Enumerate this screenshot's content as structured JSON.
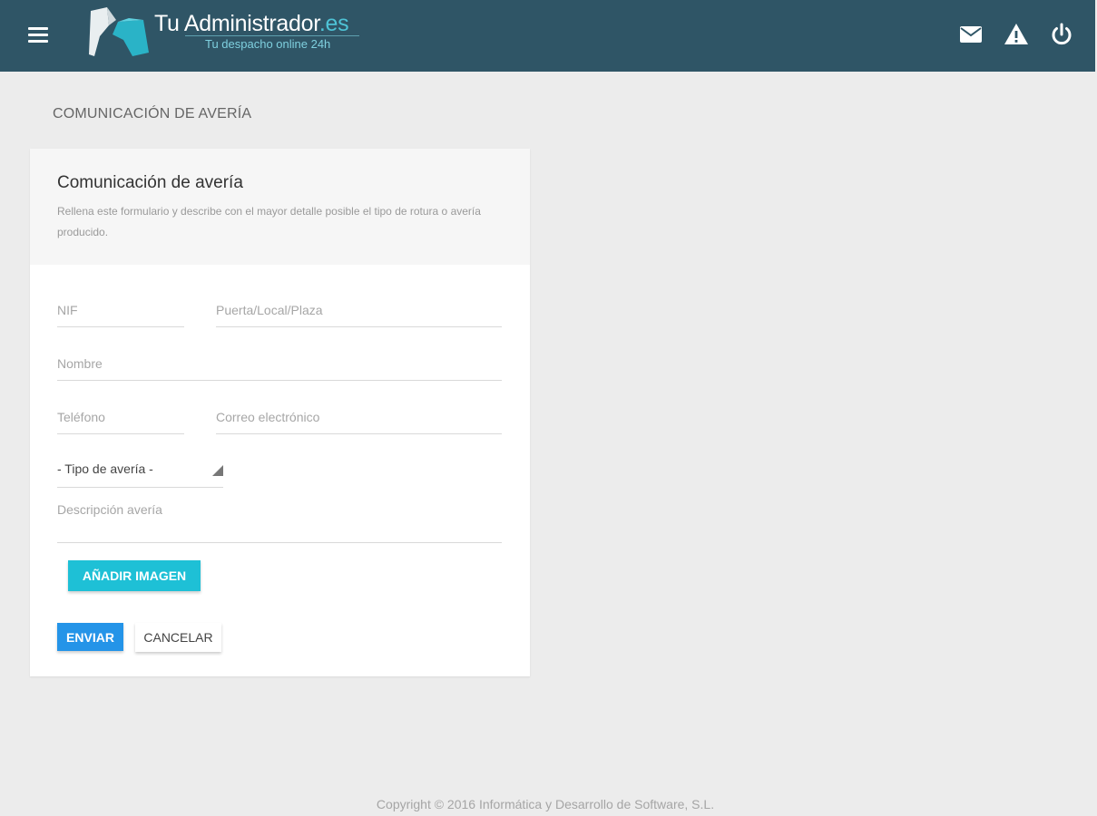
{
  "header": {
    "logo_title": "Tu Administrador",
    "logo_domain": ".es",
    "logo_subtitle": "Tu despacho online 24h",
    "menu_icon": "hamburger-menu-icon",
    "icons": [
      "mail-icon",
      "warning-icon",
      "power-icon"
    ],
    "colors": {
      "bar": "#2f5566",
      "accent": "#4ec3d6"
    }
  },
  "page": {
    "title": "COMUNICACIÓN DE AVERÍA"
  },
  "form": {
    "title": "Comunicación de avería",
    "description": "Rellena este formulario y describe con el mayor detalle posible el tipo de rotura o avería producido.",
    "fields": {
      "nif_placeholder": "NIF",
      "puerta_placeholder": "Puerta/Local/Plaza",
      "nombre_placeholder": "Nombre",
      "telefono_placeholder": "Teléfono",
      "correo_placeholder": "Correo electrónico",
      "tipo_selected": "- Tipo de avería -",
      "descripcion_placeholder": "Descripción avería"
    },
    "buttons": {
      "add_image": "AÑADIR IMAGEN",
      "send": "ENVIAR",
      "cancel": "CANCELAR"
    },
    "colors": {
      "add_image": "#1ec0d6",
      "send": "#2494e8"
    }
  },
  "footer": {
    "copyright": "Copyright © 2016 Informática y Desarrollo de Software, S.L."
  }
}
